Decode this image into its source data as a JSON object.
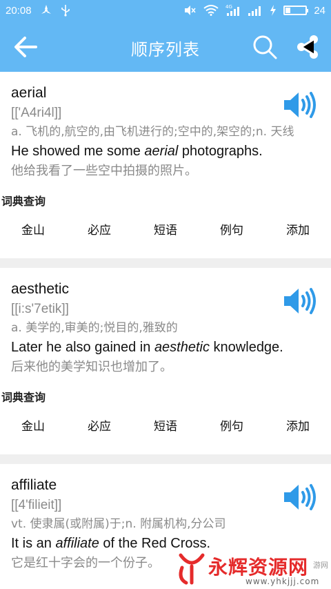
{
  "status_bar": {
    "time": "20:08",
    "battery_text": "24",
    "battery_level": 0.24,
    "icons": [
      "fan-icon",
      "usb-icon",
      "mute-icon",
      "wifi-icon",
      "signal-4g-icon",
      "signal-icon",
      "charging-icon",
      "battery-icon"
    ]
  },
  "app_bar": {
    "title": "顺序列表",
    "back_icon": "arrow-left-icon",
    "search_icon": "search-icon",
    "share_icon": "share-icon",
    "color": "#63b8f4"
  },
  "entries": [
    {
      "word": "aerial",
      "phonetic": "[['A4ri4l]]",
      "definition": "a. 飞机的,航空的,由飞机进行的;空中的,架空的;n. 天线",
      "example_en_before": "He showed me some ",
      "example_en_word": "aerial",
      "example_en_after": " photographs.",
      "example_zh": "他给我看了一些空中拍摄的照片。",
      "dict_label": "词典查询",
      "actions": [
        "金山",
        "必应",
        "短语",
        "例句",
        "添加"
      ]
    },
    {
      "word": "aesthetic",
      "phonetic": "[[i:s'7etik]]",
      "definition": "a. 美学的,审美的;悦目的,雅致的",
      "example_en_before": "Later he also gained in ",
      "example_en_word": "aesthetic",
      "example_en_after": " knowledge.",
      "example_zh": "后来他的美学知识也增加了。",
      "dict_label": "词典查询",
      "actions": [
        "金山",
        "必应",
        "短语",
        "例句",
        "添加"
      ]
    },
    {
      "word": "affiliate",
      "phonetic": "[[4'filieit]]",
      "definition": "vt. 使隶属(或附属)于;n. 附属机构,分公司",
      "example_en_before": "It is an ",
      "example_en_word": "affiliate",
      "example_en_after": " of the Red Cross.",
      "example_zh": "它是红十字会的一个份子。"
    }
  ],
  "watermark": {
    "text": "永辉资源网",
    "small": "游网",
    "url": "www.yhkjjj.com"
  },
  "colors": {
    "accent": "#63b8f4",
    "speaker": "#2f9ae8",
    "watermark": "#e52b2b"
  }
}
